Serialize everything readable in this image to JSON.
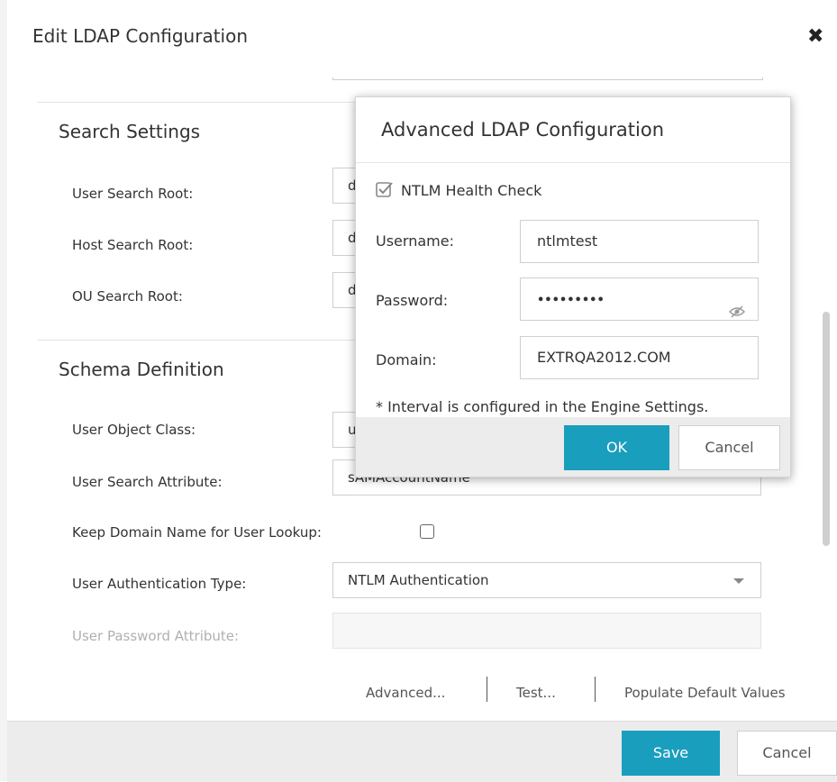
{
  "dialog": {
    "title": "Edit LDAP Configuration",
    "close_icon": "close-icon"
  },
  "sections": {
    "search_settings": {
      "title": "Search Settings",
      "fields": [
        {
          "label": "User Search Root:",
          "value": "d"
        },
        {
          "label": "Host Search Root:",
          "value": "d"
        },
        {
          "label": "OU Search Root:",
          "value": "d"
        }
      ]
    },
    "schema_definition": {
      "title": "Schema Definition",
      "user_object_class": {
        "label": "User Object Class:",
        "value": "u"
      },
      "user_search_attribute": {
        "label": "User Search Attribute:",
        "value": "sAMAccountName"
      },
      "keep_domain": {
        "label": "Keep Domain Name for User Lookup:",
        "checked": false
      },
      "auth_type": {
        "label": "User Authentication Type:",
        "value": "NTLM Authentication"
      },
      "password_attribute": {
        "label": "User Password Attribute:",
        "value": ""
      }
    }
  },
  "links": {
    "advanced": "Advanced...",
    "test": "Test...",
    "populate": "Populate Default Values"
  },
  "footer": {
    "save": "Save",
    "cancel": "Cancel"
  },
  "popup": {
    "title": "Advanced LDAP Configuration",
    "ntlm_health_check": {
      "label": "NTLM Health Check",
      "checked": true
    },
    "username": {
      "label": "Username:",
      "value": "ntlmtest"
    },
    "password": {
      "label": "Password:",
      "value": "•••••••••"
    },
    "domain": {
      "label": "Domain:",
      "value": "EXTRQA2012.COM"
    },
    "note": "* Interval is configured in the Engine Settings.",
    "ok": "OK",
    "cancel": "Cancel"
  },
  "colors": {
    "primary": "#1a9ebd",
    "footer_bg": "#ececec"
  }
}
